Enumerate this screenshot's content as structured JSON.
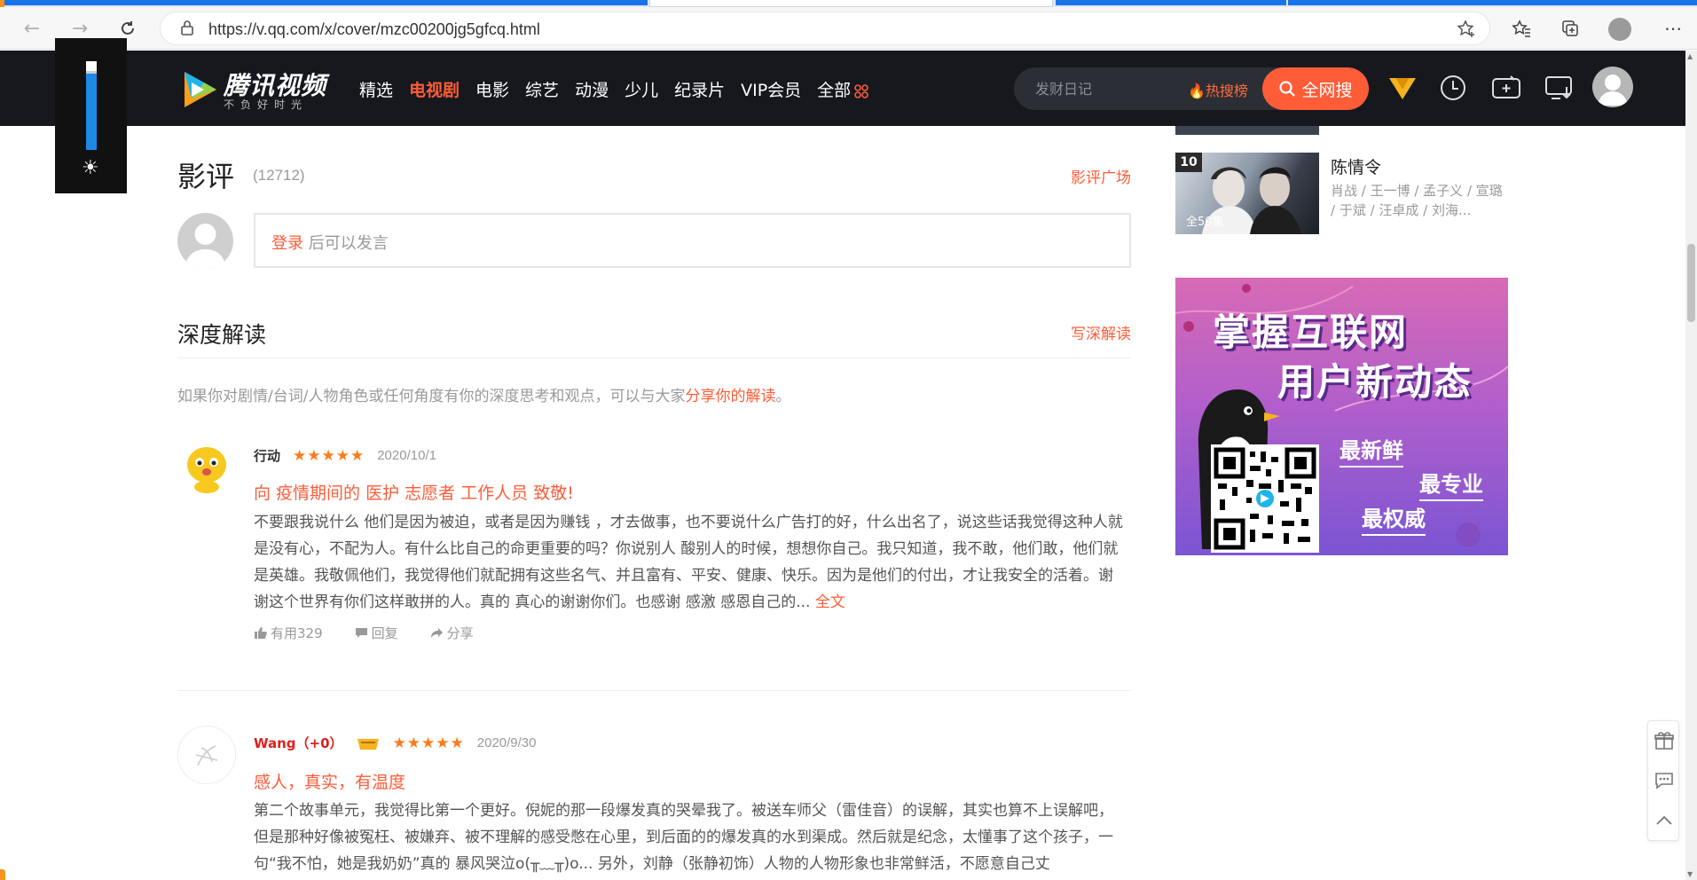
{
  "browser": {
    "url": "https://v.qq.com/x/cover/mzc00200jg5gfcq.html"
  },
  "header": {
    "logo_text": "腾讯视频",
    "logo_sub": "不负好时光",
    "nav": [
      "精选",
      "电视剧",
      "电影",
      "综艺",
      "动漫",
      "少儿",
      "纪录片",
      "VIP会员",
      "全部"
    ],
    "active_nav": "电视剧",
    "search_placeholder": "发财日记",
    "hot_rank": "热搜榜",
    "search_button": "全网搜"
  },
  "reviews_section": {
    "title": "影评",
    "count": "(12712)",
    "plaza_link": "影评广场",
    "login_link": "登录",
    "login_suffix": " 后可以发言"
  },
  "deep_section": {
    "title": "深度解读",
    "write_link": "写深解读",
    "desc_prefix": "如果你对剧情/台词/人物角色或任何角度有你的深度思考和观点，可以与大家",
    "desc_link": "分享你的解读",
    "desc_suffix": "。"
  },
  "reviews": [
    {
      "user": "行动",
      "stars": "★★★★★",
      "date": "2020/10/1",
      "title": "向 疫情期间的 医护 志愿者 工作人员 致敬!",
      "body": "不要跟我说什么 他们是因为被迫，或者是因为赚钱 ，才去做事，也不要说什么广告打的好，什么出名了，说这些话我觉得这种人就是没有心，不配为人。有什么比自己的命更重要的吗？你说别人 酸别人的时候，想想你自己。我只知道，我不敢，他们敢，他们就是英雄。我敬佩他们，我觉得他们就配拥有这些名气、并且富有、平安、健康、快乐。因为是他们的付出，才让我安全的活着。谢谢这个世界有你们这样敢拼的人。真的 真心的谢谢你们。也感谢 感激 感恩自己的...",
      "full_link": "全文",
      "useful": "有用329",
      "reply": "回复",
      "share": "分享"
    },
    {
      "user": "Wang（+0）",
      "stars": "★★★★★",
      "date": "2020/9/30",
      "title": "感人，真实，有温度",
      "body": "第二个故事单元，我觉得比第一个更好。倪妮的那一段爆发真的哭晕我了。被送车师父（雷佳音）的误解，其实也算不上误解吧，但是那种好像被冤枉、被嫌弃、被不理解的感受憋在心里，到后面的的爆发真的水到渠成。然后就是纪念，太懂事了这个孩子，一句“我不怕，她是我奶奶”真的 暴风哭泣o(╥﹏╥)o... 另外，刘静（张静初饰）人物的人物形象也非常鲜活，不愿意自己丈"
    }
  ],
  "rank": {
    "num": "10",
    "episodes": "全50集",
    "title": "陈情令",
    "cast": "肖战 / 王一博 / 孟子义 / 宣璐 / 于斌 / 汪卓成 / 刘海..."
  },
  "ad": {
    "line1": "掌握互联网",
    "line2": "用户新动态",
    "tag1": "最新鲜",
    "tag2": "最专业",
    "tag3": "最权威"
  },
  "colors": {
    "accent": "#ff5c38",
    "header_bg": "#16181e",
    "star": "#ff7a1a"
  }
}
